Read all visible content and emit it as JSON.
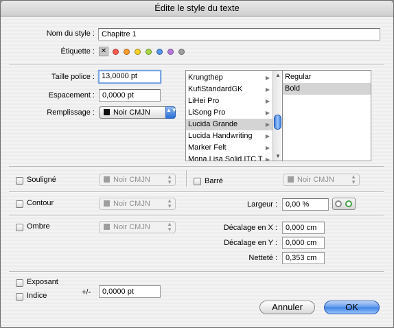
{
  "window": {
    "title": "Édite le style du texte"
  },
  "style_name": {
    "label": "Nom du style :",
    "value": "Chapitre 1"
  },
  "etiquette": {
    "label": "Étiquette :",
    "none_symbol": "✕",
    "colors": [
      "#ff5a4e",
      "#ff9b2f",
      "#f6d12b",
      "#a6d742",
      "#5596f2",
      "#b779dc",
      "#a0a0a0"
    ]
  },
  "size": {
    "label": "Taille police :",
    "value": "13,0000 pt"
  },
  "spacing": {
    "label": "Espacement :",
    "value": "0,0000 pt"
  },
  "fill": {
    "label": "Remplissage :",
    "value": "Noir CMJN"
  },
  "font_list": {
    "items": [
      "Krungthep",
      "KufiStandardGK",
      "LiHei Pro",
      "LiSong Pro",
      "Lucida Grande",
      "Lucida Handwriting",
      "Marker Felt",
      "Mona Lisa Solid ITC T"
    ],
    "selected_index": 4,
    "submenu_arrow": "▶"
  },
  "style_list": {
    "items": [
      "Regular",
      "Bold"
    ],
    "selected_index": 1
  },
  "underline": {
    "label": "Souligné",
    "color": "Noir CMJN"
  },
  "strike": {
    "label": "Barré",
    "color": "Noir CMJN"
  },
  "outline": {
    "label": "Contour",
    "color": "Noir CMJN",
    "width_label": "Largeur :",
    "width_value": "0,00 %"
  },
  "shadow": {
    "label": "Ombre",
    "color": "Noir CMJN",
    "offset_x_label": "Décalage en X :",
    "offset_x": "0,000 cm",
    "offset_y_label": "Décalage  en Y :",
    "offset_y": "0,000 cm",
    "sharpness_label": "Netteté :",
    "sharpness": "0,353 cm"
  },
  "superscript": {
    "label": "Exposant"
  },
  "subscript": {
    "label": "Indice"
  },
  "offset": {
    "label": "+/-",
    "value": "0,0000 pt"
  },
  "buttons": {
    "cancel": "Annuler",
    "ok": "OK"
  },
  "glyphs": {
    "up": "▲",
    "down": "▼"
  }
}
